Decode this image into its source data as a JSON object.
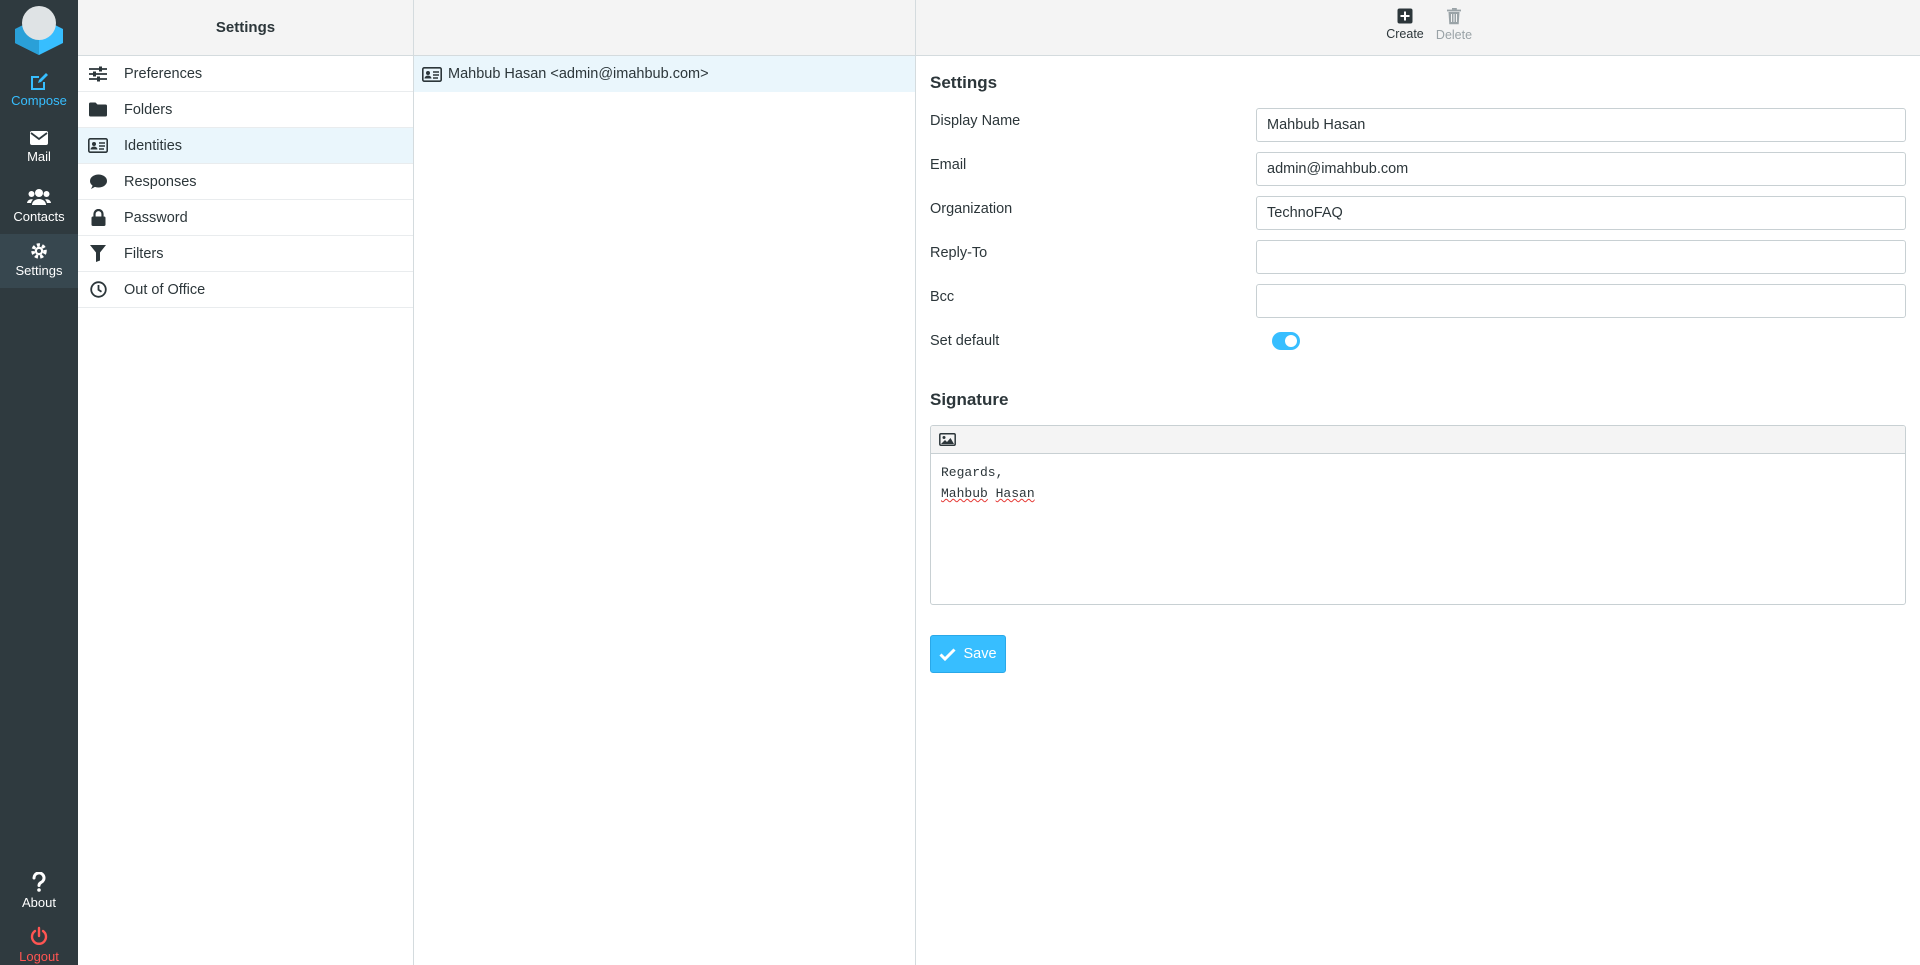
{
  "nav": {
    "compose": "Compose",
    "mail": "Mail",
    "contacts": "Contacts",
    "settings": "Settings",
    "about": "About",
    "logout": "Logout",
    "accent_color": "#37beff",
    "logout_color": "#ff5552"
  },
  "settings_panel": {
    "title": "Settings",
    "items": [
      {
        "label": "Preferences",
        "icon": "sliders-icon"
      },
      {
        "label": "Folders",
        "icon": "folder-icon"
      },
      {
        "label": "Identities",
        "icon": "id-card-icon"
      },
      {
        "label": "Responses",
        "icon": "comment-icon"
      },
      {
        "label": "Password",
        "icon": "lock-icon"
      },
      {
        "label": "Filters",
        "icon": "filter-icon"
      },
      {
        "label": "Out of Office",
        "icon": "clock-icon"
      }
    ],
    "selected": "Identities"
  },
  "identities": {
    "items": [
      {
        "label": "Mahbub Hasan <admin@imahbub.com>"
      }
    ]
  },
  "toolbar": {
    "create": "Create",
    "delete": "Delete"
  },
  "form": {
    "section_title": "Settings",
    "display_name_label": "Display Name",
    "display_name_value": "Mahbub Hasan",
    "email_label": "Email",
    "email_value": "admin@imahbub.com",
    "organization_label": "Organization",
    "organization_value": "TechnoFAQ",
    "reply_to_label": "Reply-To",
    "reply_to_value": "",
    "bcc_label": "Bcc",
    "bcc_value": "",
    "set_default_label": "Set default",
    "set_default_on": true,
    "signature_title": "Signature",
    "signature_line1": "Regards,",
    "signature_name_first": "Mahbub",
    "signature_name_last": "Hasan",
    "save_label": "Save"
  }
}
